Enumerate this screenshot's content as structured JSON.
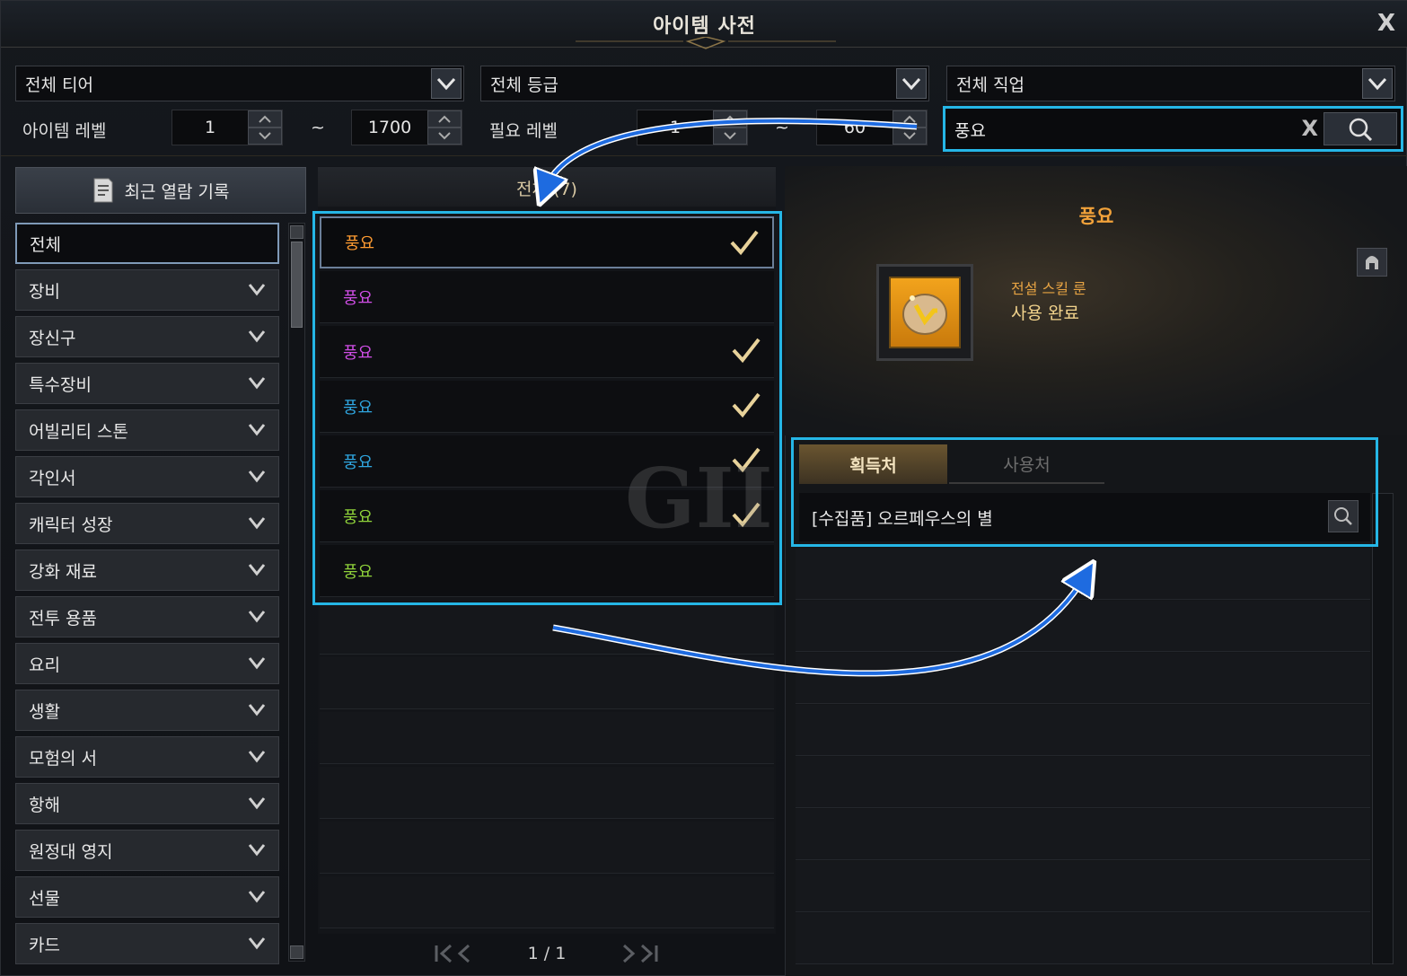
{
  "window": {
    "title": "아이템 사전",
    "close_label": "X"
  },
  "filters": {
    "tier": "전체 티어",
    "grade": "전체 등급",
    "class": "전체 직업",
    "item_level_label": "아이템 레벨",
    "item_level_min": "1",
    "range_sep": "~",
    "item_level_max": "1700",
    "req_level_label": "필요 레벨",
    "req_level_min": "1",
    "req_level_max": "60"
  },
  "search": {
    "value": "풍요",
    "clear_label": "X"
  },
  "sidebar": {
    "recent_label": "최근 열람 기록",
    "items": [
      {
        "label": "전체",
        "active": true
      },
      {
        "label": "장비"
      },
      {
        "label": "장신구"
      },
      {
        "label": "특수장비"
      },
      {
        "label": "어빌리티 스톤"
      },
      {
        "label": "각인서"
      },
      {
        "label": "캐릭터 성장"
      },
      {
        "label": "강화 재료"
      },
      {
        "label": "전투 용품"
      },
      {
        "label": "요리"
      },
      {
        "label": "생활"
      },
      {
        "label": "모험의 서"
      },
      {
        "label": "항해"
      },
      {
        "label": "원정대 영지"
      },
      {
        "label": "선물"
      },
      {
        "label": "카드"
      }
    ]
  },
  "results": {
    "header": "전체 (7)",
    "rows": [
      {
        "name": "풍요",
        "color": "#ff9c32",
        "checked": true
      },
      {
        "name": "풍요",
        "color": "#d04ee6",
        "checked": false
      },
      {
        "name": "풍요",
        "color": "#d04ee6",
        "checked": true
      },
      {
        "name": "풍요",
        "color": "#2fa6e0",
        "checked": true
      },
      {
        "name": "풍요",
        "color": "#2fa6e0",
        "checked": true
      },
      {
        "name": "풍요",
        "color": "#8fd23a",
        "checked": true
      },
      {
        "name": "풍요",
        "color": "#8fd23a",
        "checked": false
      }
    ],
    "page": "1 / 1"
  },
  "detail": {
    "name": "풍요",
    "type": "전설 스킬 룬",
    "status": "사용 완료",
    "tabs": [
      "획득처",
      "사용처"
    ],
    "source": "[수집품] 오르페우스의 별"
  },
  "watermark": "GII"
}
